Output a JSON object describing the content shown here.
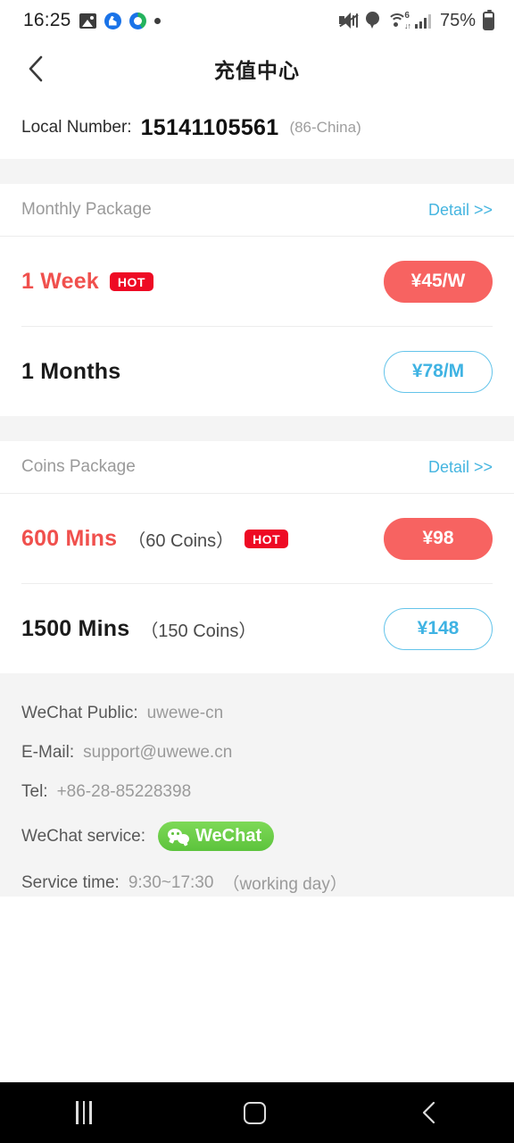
{
  "status_bar": {
    "time": "16:25",
    "battery_percent": "75%",
    "left_icons": [
      "photo-icon",
      "accessibility-icon",
      "sync-icon",
      "dot-icon"
    ],
    "right_icons": [
      "mute-icon",
      "location-pin-icon",
      "wifi-6-icon",
      "signal-bars-icon",
      "battery-icon"
    ],
    "wifi_generation": "6"
  },
  "titlebar": {
    "back_icon": "chevron-left-icon",
    "title": "充值中心"
  },
  "local_number": {
    "label": "Local Number:",
    "value": "15141105561",
    "region": "(86-China)"
  },
  "sections": [
    {
      "title": "Monthly Package",
      "detail_label": "Detail >>",
      "rows": [
        {
          "name": "1 Week",
          "sub": "",
          "badge": "HOT",
          "price": "¥45/W",
          "style": "filled"
        },
        {
          "name": "1 Months",
          "sub": "",
          "badge": "",
          "price": "¥78/M",
          "style": "outline"
        }
      ]
    },
    {
      "title": "Coins Package",
      "detail_label": "Detail >>",
      "rows": [
        {
          "name": "600 Mins",
          "sub": "（60 Coins）",
          "badge": "HOT",
          "price": "¥98",
          "style": "filled"
        },
        {
          "name": "1500 Mins",
          "sub": "（150 Coins）",
          "badge": "",
          "price": "¥148",
          "style": "outline"
        }
      ]
    }
  ],
  "footer": {
    "wechat_public_label": "WeChat Public:",
    "wechat_public_value": "uwewe-cn",
    "email_label": "E-Mail:",
    "email_value": "support@uwewe.cn",
    "tel_label": "Tel:",
    "tel_value": "+86-28-85228398",
    "wechat_service_label": "WeChat service:",
    "wechat_badge_text": "WeChat",
    "service_time_label": "Service time:",
    "service_time_value": "9:30~17:30",
    "service_time_note": "（working day）"
  },
  "navbar": {
    "recents": "recents-icon",
    "home": "home-icon",
    "back": "back-icon"
  },
  "colors": {
    "accent_red": "#f76361",
    "hot_red": "#ee0a24",
    "accent_blue": "#45b5e0",
    "wechat_green": "#5cc33c"
  }
}
